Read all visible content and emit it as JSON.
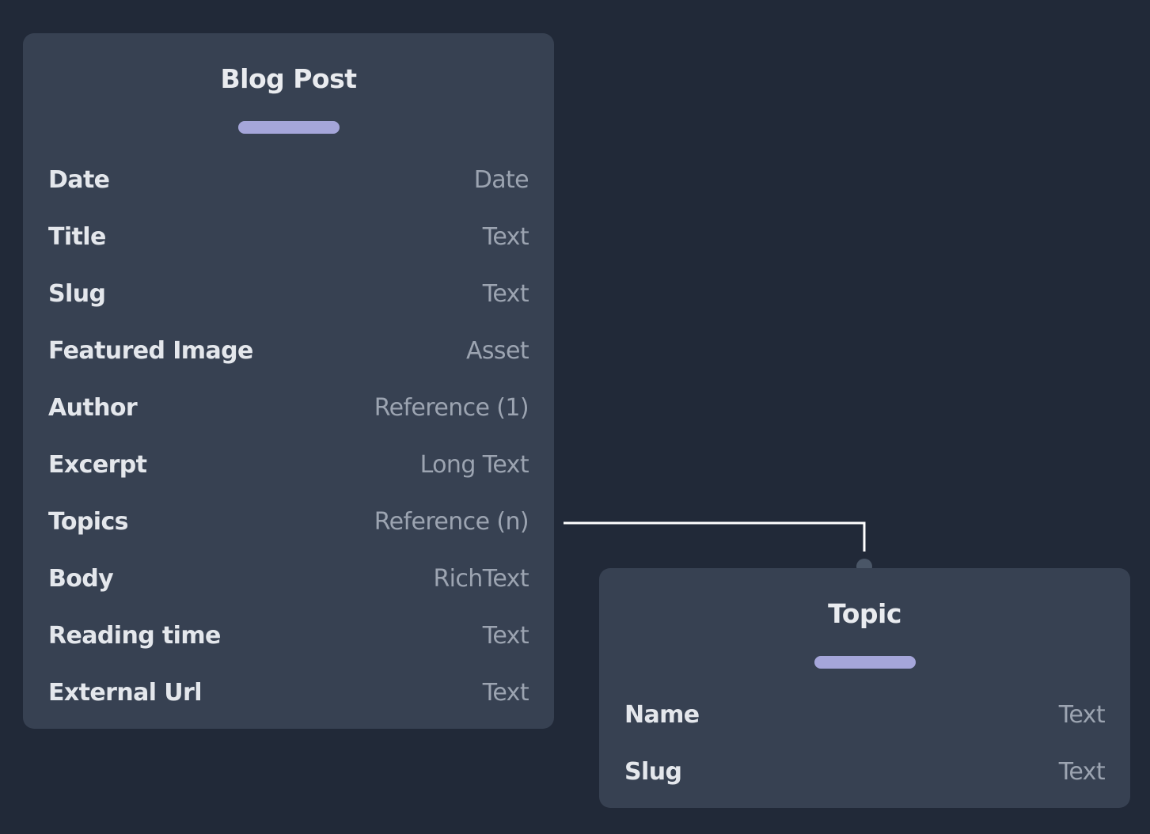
{
  "colors": {
    "background": "#212938",
    "card": "#374152",
    "accent": "#a5a6da",
    "connector": "#ffffff",
    "connector_dot": "#4a5667",
    "field_name": "#e4e7ec",
    "field_type": "#9ca4b1"
  },
  "models": [
    {
      "id": "blog-post",
      "title": "Blog Post",
      "fields": [
        {
          "name": "Date",
          "type": "Date"
        },
        {
          "name": "Title",
          "type": "Text"
        },
        {
          "name": "Slug",
          "type": "Text"
        },
        {
          "name": "Featured Image",
          "type": "Asset"
        },
        {
          "name": "Author",
          "type": "Reference (1)"
        },
        {
          "name": "Excerpt",
          "type": "Long Text"
        },
        {
          "name": "Topics",
          "type": "Reference (n)"
        },
        {
          "name": "Body",
          "type": "RichText"
        },
        {
          "name": "Reading time",
          "type": "Text"
        },
        {
          "name": "External Url",
          "type": "Text"
        }
      ]
    },
    {
      "id": "topic",
      "title": "Topic",
      "fields": [
        {
          "name": "Name",
          "type": "Text"
        },
        {
          "name": "Slug",
          "type": "Text"
        }
      ]
    }
  ],
  "relations": [
    {
      "from_model": "Blog Post",
      "from_field": "Topics",
      "to_model": "Topic"
    }
  ]
}
